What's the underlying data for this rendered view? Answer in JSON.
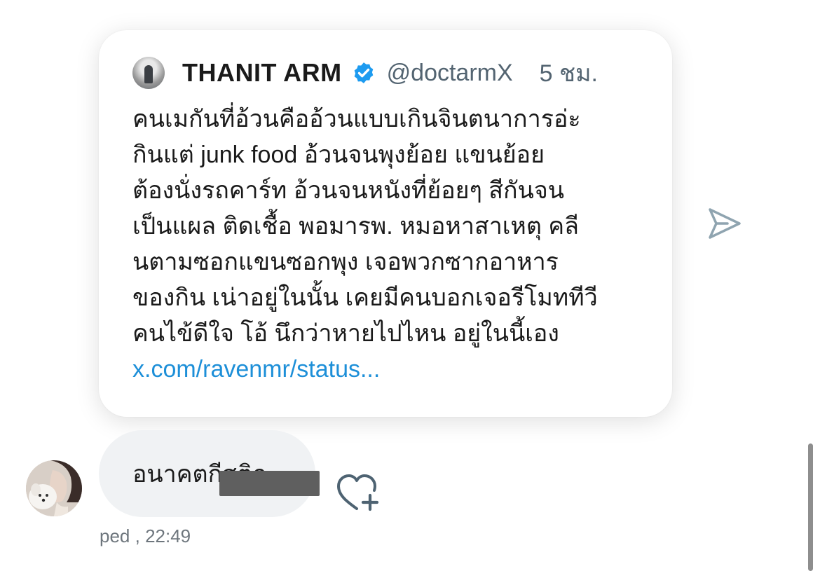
{
  "quoted_tweet": {
    "author_name": "THANIT ARM",
    "handle": "@doctarmX",
    "time": "5 ชม.",
    "verified": true,
    "body_lines": [
      "คนเมกันที่อ้วนคืออ้วนแบบเกินจินตนาการอ่ะ",
      "กินแต่ junk food อ้วนจนพุงย้อย แขนย้อย",
      "ต้องนั่งรถคาร์ท อ้วนจนหนังที่ย้อยๆ สีกันจน",
      "เป็นแผล ติดเชื้อ พอมารพ. หมอหาสาเหตุ คลี",
      "นตามซอกแขนซอกพุง เจอพวกซากอาหาร",
      "ของกิน เน่าอยู่ในนั้น เคยมีคนบอกเจอรีโมททีวี",
      "คนไข้ดีใจ โอ้ นึกว่าหายไปไหน อยู่ในนี้เอง"
    ],
    "link": "x.com/ravenmr/status..."
  },
  "message": {
    "text": "อนาคตกีสติก",
    "sender": "ped",
    "time": ", 22:49",
    "meta_separator": " "
  },
  "icons": {
    "verified": "verified-badge-icon",
    "share": "send-icon",
    "react": "heart-plus-icon",
    "avatar": "user-avatar"
  },
  "colors": {
    "link": "#1d8fd8",
    "verified": "#1d9bf0",
    "icon_gray": "#8fa4b0",
    "bubble": "#f0f2f4"
  }
}
